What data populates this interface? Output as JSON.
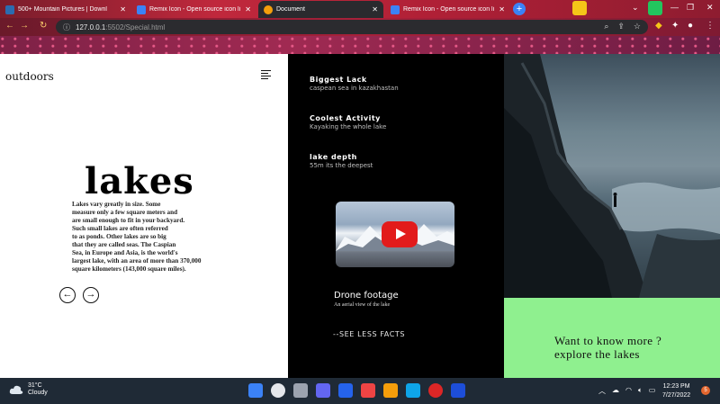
{
  "browser": {
    "tabs": [
      {
        "title": "500+ Mountain Pictures | Downl",
        "active": false,
        "favicon_color": "#2b6cb0"
      },
      {
        "title": "Remix Icon - Open source icon li",
        "active": false,
        "favicon_color": "#3b82f6"
      },
      {
        "title": "Document",
        "active": true,
        "favicon_color": "#f59e0b"
      },
      {
        "title": "Remix Icon - Open source icon li",
        "active": false,
        "favicon_color": "#3b82f6"
      }
    ],
    "new_tab_label": "+",
    "url_host": "127.0.0.1",
    "url_path": ":5502/Special.html"
  },
  "page": {
    "brand": "outdoors",
    "heading": "lakes",
    "paragraph": "Lakes vary greatly in size. Some\nmeasure only a few square meters and\nare small enough to fit in your backyard.\nSuch small lakes are often referred\nto as ponds. Other lakes are so big\nthat they are called seas. The Caspian\nSea, in Europe and Asia, is the world's\nlargest lake, with an area of more than 370,000\nsquare kilometers (143,000 square miles).",
    "prev_arrow": "←",
    "next_arrow": "→",
    "facts": [
      {
        "title": "Biggest Lack",
        "desc": "caspean sea in kazakhastan"
      },
      {
        "title": "Coolest Activity",
        "desc": "Kayaking the whole lake"
      },
      {
        "title": "lake depth",
        "desc": "55m its the deepest"
      }
    ],
    "video_title": "Drone footage",
    "video_sub": "An aerial view of the lake",
    "less_facts": "--SEE LESS FACTS",
    "cta": "Want to know more ?\nexplore the lakes"
  },
  "taskbar": {
    "temp": "31°C",
    "condition": "Cloudy",
    "time": "12:23 PM",
    "date": "7/27/2022",
    "notifications": "5",
    "app_colors": [
      "#3b82f6",
      "#e5e7eb",
      "#9ca3af",
      "#6366f1",
      "#2563eb",
      "#ef4444",
      "#f59e0b",
      "#0ea5e9",
      "#dc2626",
      "#1d4ed8"
    ]
  },
  "colors": {
    "cta_bg": "#8ff08f",
    "mid_bg": "#000000",
    "youtube_red": "#e21b1b"
  }
}
